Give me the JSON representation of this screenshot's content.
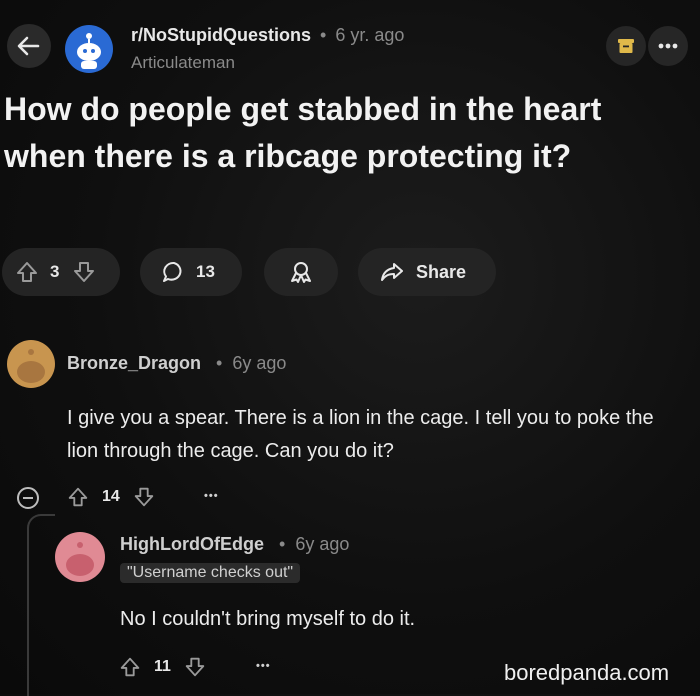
{
  "header": {
    "community": "r/NoStupidQuestions",
    "separator": "•",
    "post_age": "6 yr. ago",
    "author": "Articulateman"
  },
  "post": {
    "title": "How do people get stabbed in the heart when there is a ribcage protecting it?"
  },
  "actions": {
    "votes": "3",
    "comments": "13",
    "share_label": "Share"
  },
  "comments": [
    {
      "author": "Bronze_Dragon",
      "age": "6y ago",
      "text": "I give you a spear. There is a lion in the cage. I tell you to poke the lion through the cage. Can you do it?",
      "votes": "14",
      "more": "•••"
    },
    {
      "author": "HighLordOfEdge",
      "age": "6y ago",
      "flair": "\"Username checks out\"",
      "text": "No I couldn't bring myself to do it.",
      "votes": "11",
      "more": "•••"
    }
  ],
  "watermark": "boredpanda.com",
  "colors": {
    "background": "#0f0f0f",
    "text": "#e8e8e8",
    "muted": "#8a8a8a",
    "bookmark": "#e0b94a",
    "avatar_community": "#2a6ad4",
    "avatar_bronze": "#c8954f",
    "avatar_high": "#e08a94"
  },
  "icons": [
    "back-arrow-icon",
    "bookmark-icon",
    "more-icon",
    "upvote-icon",
    "downvote-icon",
    "comment-icon",
    "award-icon",
    "share-icon",
    "collapse-icon"
  ]
}
